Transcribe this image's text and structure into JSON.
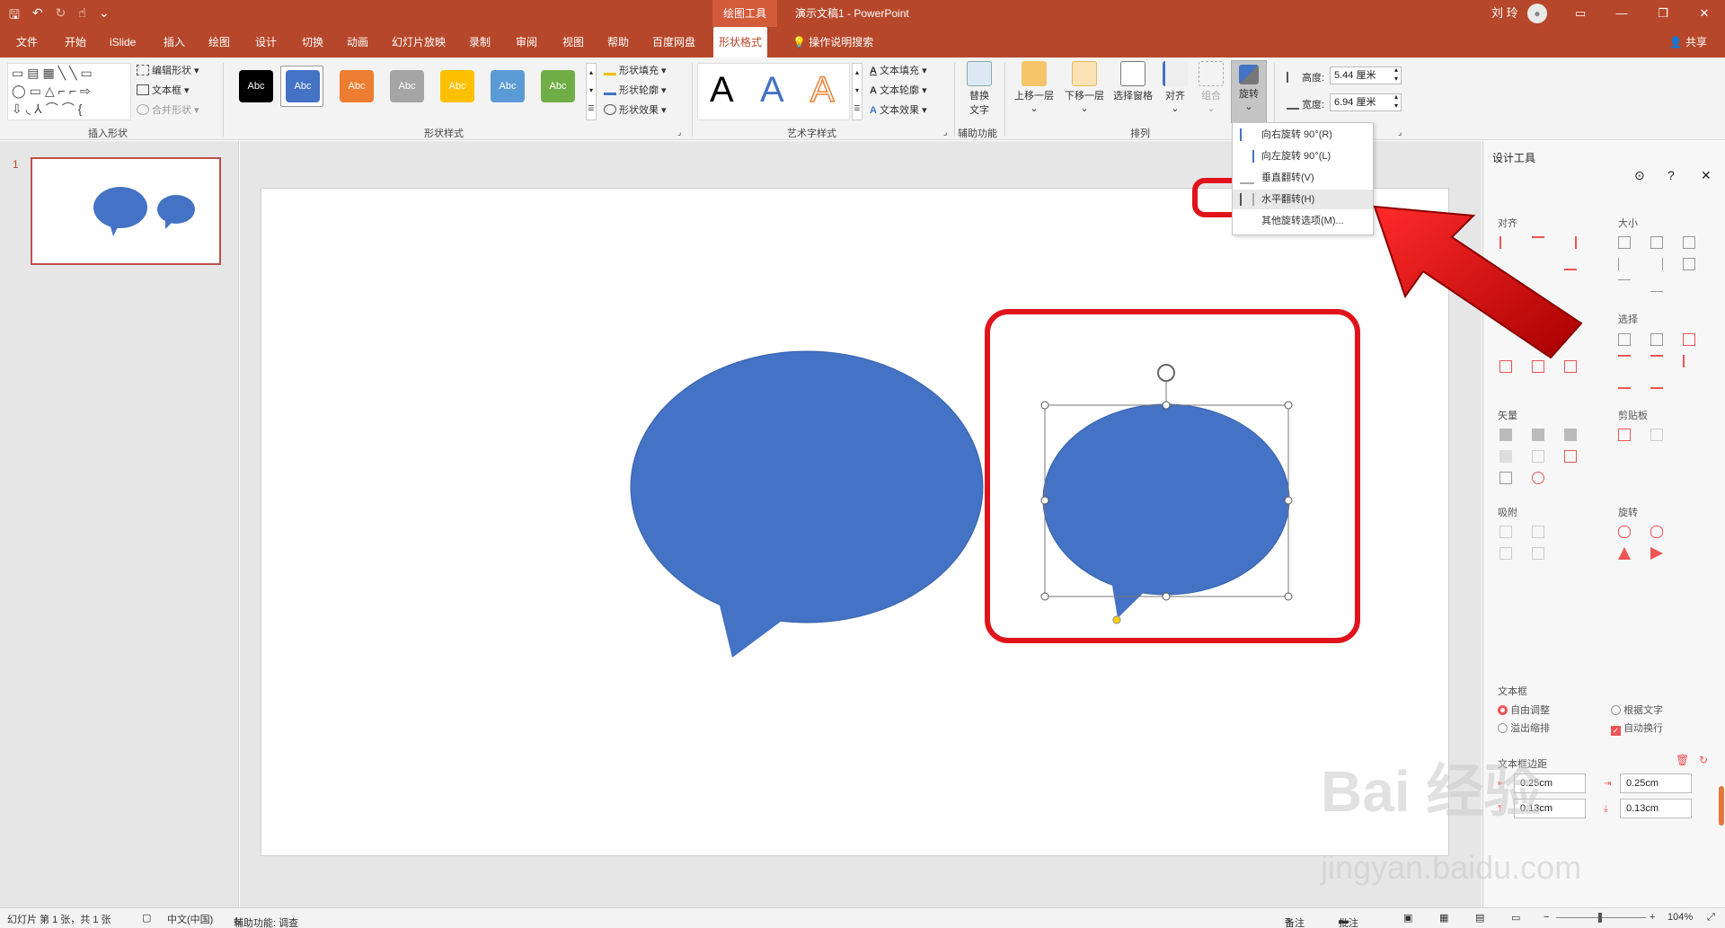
{
  "titlebar": {
    "context_tab": "绘图工具",
    "document_title": "演示文稿1  -  PowerPoint",
    "user": "刘 玲",
    "avatar_icon": "user-icon",
    "qat_icons": [
      "save-icon",
      "undo-icon",
      "redo-icon",
      "touch-mode-icon",
      "customize-icon"
    ]
  },
  "tabs": {
    "items": [
      "文件",
      "开始",
      "iSlide",
      "插入",
      "绘图",
      "设计",
      "切换",
      "动画",
      "幻灯片放映",
      "录制",
      "审阅",
      "视图",
      "帮助",
      "百度网盘",
      "形状格式"
    ],
    "active": "形状格式",
    "tell_me": "操作说明搜索",
    "share": "共享"
  },
  "ribbon": {
    "insert_shapes": {
      "label": "插入形状",
      "edit_shape": "编辑形状",
      "text_box": "文本框",
      "merge_shapes": "合并形状"
    },
    "shape_styles": {
      "label": "形状样式",
      "swatches": [
        "Abc",
        "Abc",
        "Abc",
        "Abc",
        "Abc",
        "Abc",
        "Abc"
      ],
      "fill": "形状填充",
      "outline": "形状轮廓",
      "effects": "形状效果"
    },
    "wordart": {
      "label": "艺术字样式",
      "samples": [
        "A",
        "A",
        "A"
      ],
      "text_fill": "文本填充",
      "text_outline": "文本轮廓",
      "text_effects": "文本效果"
    },
    "accessibility": {
      "label": "辅助功能",
      "alt_text_1": "替换",
      "alt_text_2": "文字"
    },
    "arrange": {
      "label": "排列",
      "bring_forward": "上移一层",
      "send_backward": "下移一层",
      "selection_pane": "选择窗格",
      "align": "对齐",
      "group": "组合",
      "rotate": "旋转"
    },
    "size": {
      "height_label": "高度:",
      "height_value": "5.44 厘米",
      "width_label": "宽度:",
      "width_value": "6.94 厘米"
    }
  },
  "rotate_menu": {
    "items": [
      "向右旋转 90°(R)",
      "向左旋转 90°(L)",
      "垂直翻转(V)",
      "水平翻转(H)",
      "其他旋转选项(M)..."
    ],
    "highlighted": "水平翻转(H)"
  },
  "slides_panel": {
    "number": "1"
  },
  "right_pane": {
    "title": "设计工具",
    "sections": {
      "align": "对齐",
      "size": "大小",
      "select": "选择",
      "vector": "矢量",
      "clipboard": "剪贴板",
      "snap": "吸附",
      "rotate": "旋转"
    },
    "textbox": {
      "title": "文本框",
      "autofit": "自由调整",
      "by_text": "根据文字",
      "overflow": "溢出缩排",
      "wrap": "自动换行"
    },
    "margins": {
      "title": "文本框边距",
      "left": "0.25cm",
      "right": "0.25cm",
      "top": "0.13cm",
      "bottom": "0.13cm"
    }
  },
  "statusbar": {
    "slide_info": "幻灯片 第 1 张，共 1 张",
    "language": "中文(中国)",
    "accessibility": "辅助功能: 调查",
    "notes": "备注",
    "comments": "批注",
    "zoom": "104%"
  },
  "watermark": {
    "line1": "Bai 经验",
    "line2": "jingyan.baidu.com"
  },
  "colors": {
    "accent": "#b7472a",
    "shape_fill": "#4472c4",
    "highlight": "#e0131b"
  }
}
